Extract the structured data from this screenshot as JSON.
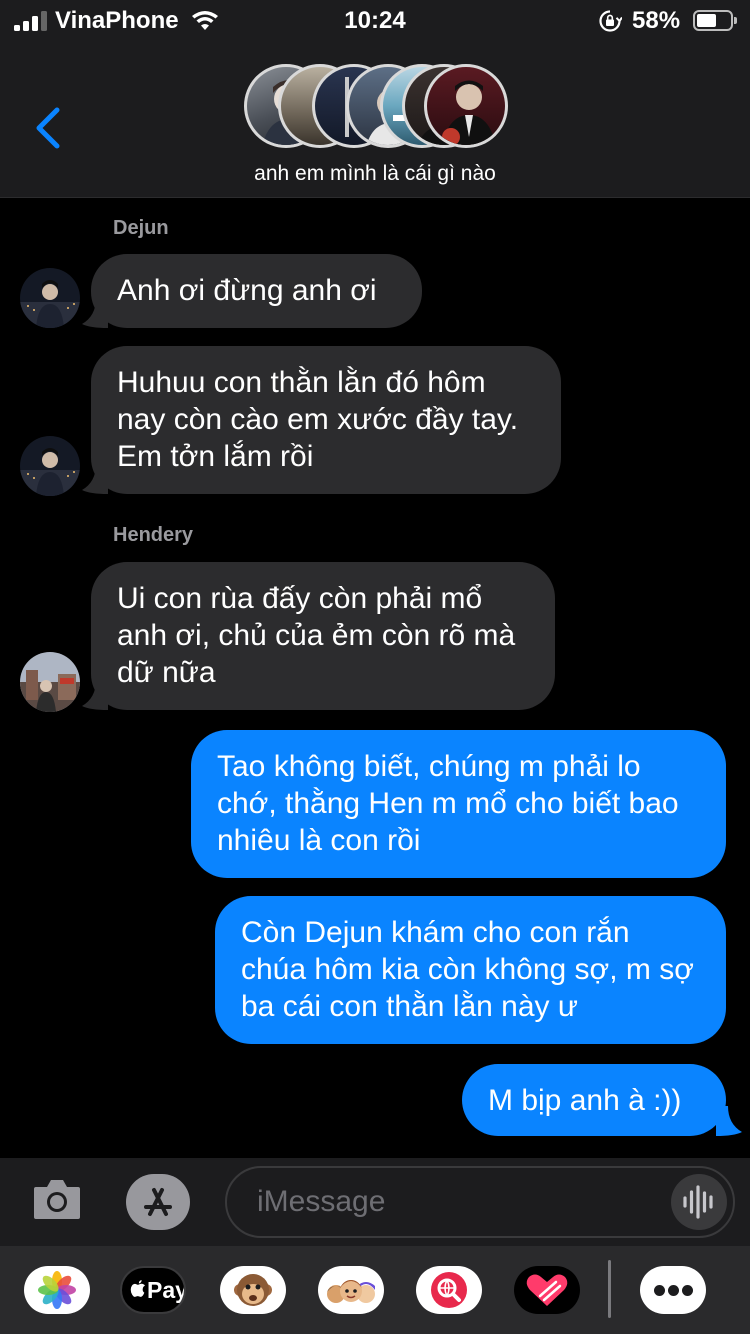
{
  "status_bar": {
    "carrier": "VinaPhone",
    "time": "10:24",
    "battery_percent": "58%",
    "battery_level": 0.58,
    "signal_bars": 3
  },
  "header": {
    "group_name": "anh em mình là cái gì nào",
    "back_icon": "chevron-left-icon"
  },
  "messages": [
    {
      "sender": "Dejun",
      "direction": "incoming",
      "text": "Anh ơi đừng anh ơi"
    },
    {
      "sender": "Dejun",
      "direction": "incoming",
      "text": "Huhuu con thằn lằn đó hôm nay còn cào em xước đầy tay. Em tởn lắm rồi"
    },
    {
      "sender": "Hendery",
      "direction": "incoming",
      "text": "Ui con rùa đấy còn phải mổ anh ơi, chủ của ẻm còn rõ mà dữ nữa"
    },
    {
      "direction": "outgoing",
      "text": "Tao không biết, chúng m phải lo chớ, thằng Hen m mổ cho biết bao nhiêu là con rồi"
    },
    {
      "direction": "outgoing",
      "text": "Còn Dejun khám cho con rắn chúa hôm kia còn không sợ, m sợ ba cái con thằn lằn này ư"
    },
    {
      "direction": "outgoing",
      "text": "M bịp anh à :))"
    }
  ],
  "input": {
    "placeholder": "iMessage",
    "camera_icon": "camera-icon",
    "apps_icon": "app-store-icon",
    "audio_icon": "waveform-icon"
  },
  "app_drawer": {
    "apple_pay_label": "Pay",
    "apps": [
      "photos-icon",
      "apple-pay-icon",
      "monkey-animoji-icon",
      "memoji-stickers-icon",
      "web-search-icon",
      "digital-touch-icon",
      "more-icon"
    ]
  },
  "colors": {
    "outgoing_bubble": "#0a84ff",
    "incoming_bubble": "#2c2c2e",
    "background": "#000000",
    "bar": "#1c1c1e"
  }
}
